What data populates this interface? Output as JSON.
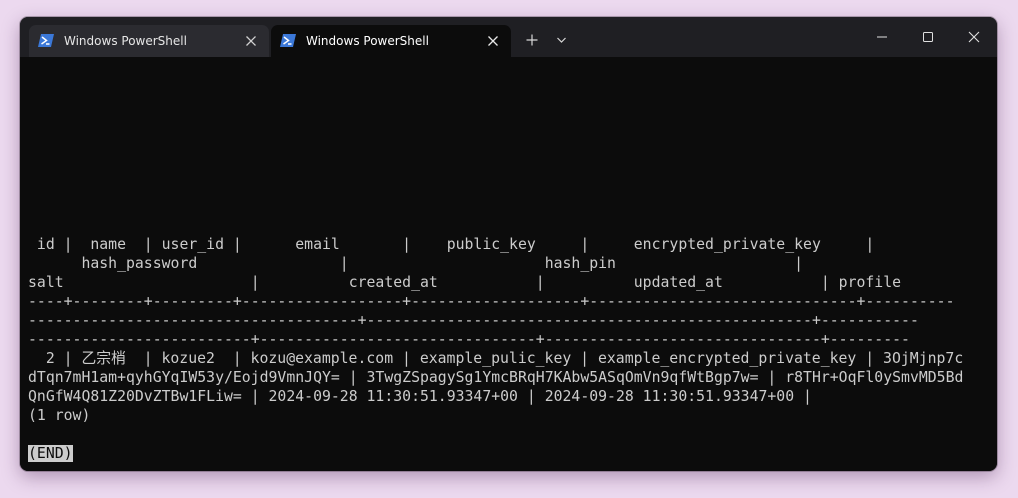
{
  "tabs": [
    {
      "title": "Windows PowerShell",
      "active": false,
      "icon": "powershell-icon"
    },
    {
      "title": "Windows PowerShell",
      "active": true,
      "icon": "powershell-icon"
    }
  ],
  "titlebar_buttons": {
    "new_tab_icon": "plus-icon",
    "dropdown_icon": "chevron-down-icon",
    "minimize_icon": "minimize-icon",
    "maximize_icon": "maximize-icon",
    "close_icon": "close-icon"
  },
  "colors": {
    "terminal_background": "#0c0c0c",
    "terminal_text": "#cccccc",
    "titlebar": "#1f1f23",
    "powershell_blue": "#3b78d8"
  },
  "terminal": {
    "header_lines": [
      " id |  name  | user_id |      email       |    public_key     |     encrypted_private_key     |",
      "      hash_password                |                      hash_pin                    |",
      "salt                     |          created_at           |          updated_at           | profile"
    ],
    "separator_lines": [
      "----+--------+---------+------------------+-------------------+------------------------------+----------",
      "-------------------------------------+--------------------------------------------------+-----------",
      "-------------------------+-------------------------------+-------------------------------+---------"
    ],
    "row_lines": [
      "  2 | 乙宗梢  | kozue2  | kozu@example.com | example_pulic_key | example_encrypted_private_key | 3OjMjnp7c",
      "dTqn7mH1am+qyhGYqIW53y/Eojd9VmnJQY= | 3TwgZSpagySg1YmcBRqH7KAbw5ASqOmVn9qfWtBgp7w= | r8THr+OqFl0ySmvMD5Bd",
      "QnGfW4Q81Z20DvZTBw1FLiw= | 2024-09-28 11:30:51.93347+00 | 2024-09-28 11:30:51.93347+00 |"
    ],
    "row_count": "(1 row)",
    "end_marker": "(END)"
  }
}
